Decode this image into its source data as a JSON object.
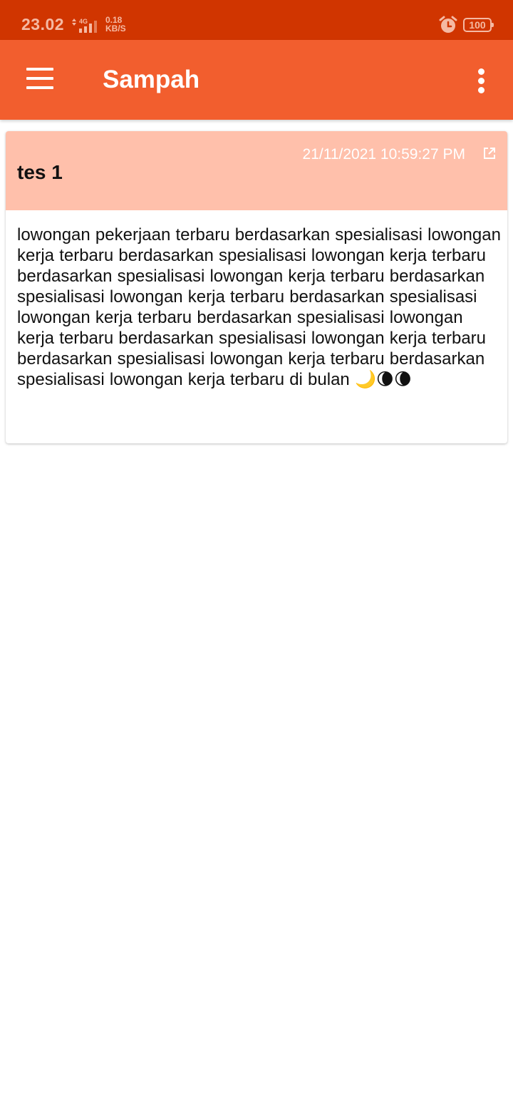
{
  "status_bar": {
    "time": "23.02",
    "network_type": "4G",
    "speed_value": "0.18",
    "speed_unit": "KB/S",
    "battery": "100",
    "icons": [
      "data-arrows-icon",
      "signal-icon",
      "alarm-icon",
      "battery-icon"
    ]
  },
  "app_bar": {
    "title": "Sampah",
    "icons": [
      "menu-icon",
      "more-vert-icon"
    ],
    "color": "#f25e2e"
  },
  "note": {
    "title": "tes 1",
    "date": "21/11/2021 10:59:27 PM",
    "body": "lowongan pekerjaan terbaru berdasarkan spesialisasi lowongan kerja terbaru berdasarkan spesialisasi lowongan kerja terbaru berdasarkan spesialisasi lowongan kerja terbaru berdasarkan spesialisasi lowongan kerja terbaru berdasarkan spesialisasi lowongan kerja terbaru berdasarkan spesialisasi lowongan kerja terbaru berdasarkan spesialisasi lowongan kerja terbaru berdasarkan spesialisasi lowongan kerja terbaru berdasarkan spesialisasi lowongan kerja terbaru di bulan 🌙🌘🌘",
    "header_color": "#ffc0ab",
    "icons": [
      "open-external-icon"
    ]
  },
  "colors": {
    "status_bar": "#d03500",
    "app_bar": "#f25e2e",
    "note_header": "#ffc0ab"
  }
}
